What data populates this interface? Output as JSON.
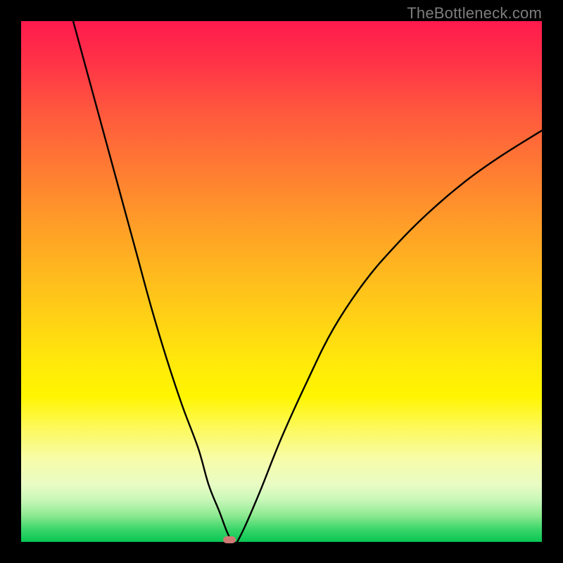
{
  "watermark": "TheBottleneck.com",
  "chart_data": {
    "type": "line",
    "title": "",
    "xlabel": "",
    "ylabel": "",
    "xlim": [
      0,
      100
    ],
    "ylim": [
      0,
      100
    ],
    "grid": false,
    "legend": null,
    "marker": {
      "x_pct": 40.0,
      "y_pct": 0.0,
      "color": "#cf7a74"
    },
    "series": [
      {
        "name": "left-branch",
        "x": [
          10,
          13,
          16,
          19,
          22,
          25,
          28,
          31,
          34,
          36,
          38,
          39.5,
          40.5
        ],
        "y": [
          100,
          89,
          78,
          67,
          56,
          45,
          35,
          26,
          18,
          11,
          6,
          2,
          0
        ]
      },
      {
        "name": "right-branch",
        "x": [
          41.5,
          43,
          46,
          50,
          55,
          60,
          66,
          72,
          78,
          85,
          92,
          100
        ],
        "y": [
          0,
          3,
          10,
          20,
          31,
          41,
          50,
          57,
          63,
          69,
          74,
          79
        ]
      }
    ],
    "background_gradient": {
      "direction": "vertical",
      "stops": [
        {
          "pct": 0,
          "color": "#ff1a4d"
        },
        {
          "pct": 50,
          "color": "#ffb81f"
        },
        {
          "pct": 72,
          "color": "#fff500"
        },
        {
          "pct": 100,
          "color": "#08c552"
        }
      ]
    }
  }
}
